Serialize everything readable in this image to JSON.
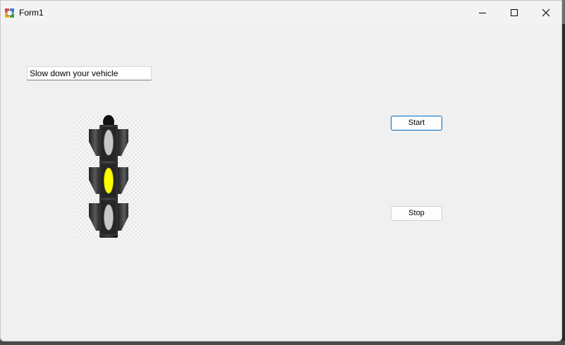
{
  "window": {
    "title": "Form1",
    "icon": "winforms-app-icon",
    "controls": {
      "minimize_icon": "minimize-icon",
      "maximize_icon": "maximize-icon",
      "close_icon": "close-icon"
    }
  },
  "form": {
    "message_text": "Slow down your vehicle",
    "traffic_light": {
      "active_light": "yellow",
      "colors": {
        "active": "#ffff00",
        "inactive": "#c8c8c8"
      }
    },
    "start_label": "Start",
    "stop_label": "Stop"
  }
}
